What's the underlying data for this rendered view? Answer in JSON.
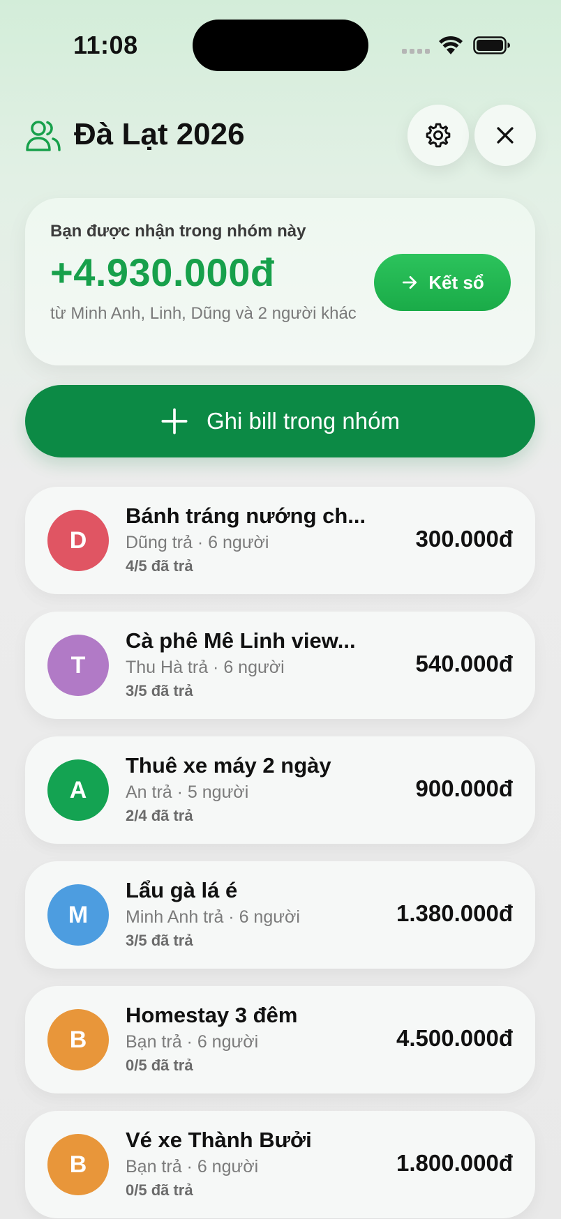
{
  "status": {
    "time": "11:08"
  },
  "header": {
    "title": "Đà Lạt 2026"
  },
  "balance": {
    "label": "Bạn được nhận trong nhóm này",
    "amount": "+4.930.000đ",
    "from": "từ Minh Anh, Linh, Dũng và 2 người khác",
    "settle_label": "Kết sổ"
  },
  "add_bill_label": "Ghi bill trong nhóm",
  "colors": {
    "accent": "#17a04b",
    "primary_button": "#0c8a45",
    "settle_button": "#22b553"
  },
  "bills": [
    {
      "initial": "D",
      "color": "#e05563",
      "name": "Bánh tráng nướng ch...",
      "sub": "Dũng trả · 6 người",
      "paid": "4/5 đã trả",
      "amount": "300.000đ"
    },
    {
      "initial": "T",
      "color": "#b17ac6",
      "name": "Cà phê Mê Linh view...",
      "sub": "Thu Hà trả · 6 người",
      "paid": "3/5 đã trả",
      "amount": "540.000đ"
    },
    {
      "initial": "A",
      "color": "#14a352",
      "name": "Thuê xe máy 2 ngày",
      "sub": "An trả · 5 người",
      "paid": "2/4 đã trả",
      "amount": "900.000đ"
    },
    {
      "initial": "M",
      "color": "#4d9de0",
      "name": "Lẩu gà lá é",
      "sub": "Minh Anh trả · 6 người",
      "paid": "3/5 đã trả",
      "amount": "1.380.000đ"
    },
    {
      "initial": "B",
      "color": "#e8963a",
      "name": "Homestay 3 đêm",
      "sub": "Bạn trả · 6 người",
      "paid": "0/5 đã trả",
      "amount": "4.500.000đ"
    },
    {
      "initial": "B",
      "color": "#e8963a",
      "name": "Vé xe Thành Bưởi",
      "sub": "Bạn trả · 6 người",
      "paid": "0/5 đã trả",
      "amount": "1.800.000đ"
    }
  ]
}
